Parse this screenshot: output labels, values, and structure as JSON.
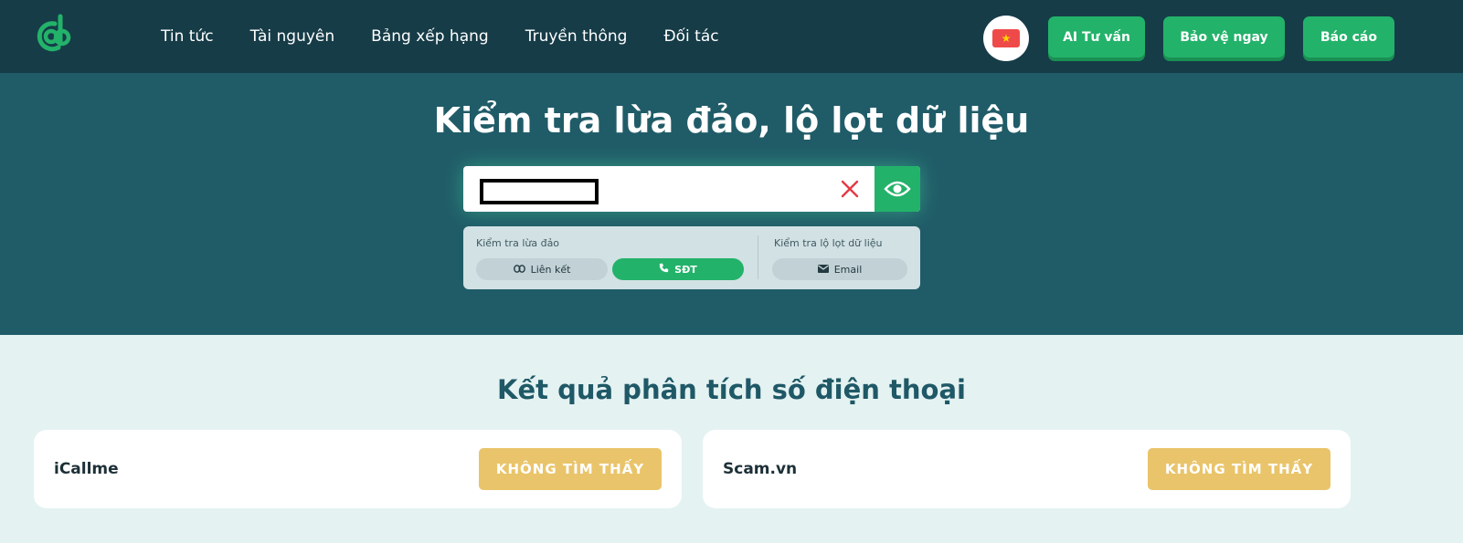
{
  "header": {
    "nav": [
      "Tin tức",
      "Tài nguyên",
      "Bảng xếp hạng",
      "Truyền thông",
      "Đối tác"
    ],
    "buttons": {
      "ai": "AI Tư vấn",
      "protect": "Bảo vệ ngay",
      "report": "Báo cáo"
    },
    "language_flag_icon": "vietnam-flag-icon"
  },
  "hero": {
    "title": "Kiểm tra lừa đảo, lộ lọt dữ liệu",
    "search": {
      "value": "",
      "placeholder": ""
    },
    "panel": {
      "scam_label": "Kiểm tra lừa đảo",
      "leak_label": "Kiểm tra lộ lọt dữ liệu",
      "options": {
        "link": "Liên kết",
        "phone": "SĐT",
        "email": "Email"
      },
      "selected": "phone"
    }
  },
  "results": {
    "title": "Kết quả phân tích số điện thoại",
    "items": [
      {
        "name": "iCallme",
        "status": "KHÔNG TÌM THẤY"
      },
      {
        "name": "Scam.vn",
        "status": "KHÔNG TÌM THẤY"
      }
    ]
  },
  "colors": {
    "header_bg": "#163c48",
    "hero_bg": "#205c68",
    "accent_green": "#23b26a",
    "page_bg": "#e4f2f2",
    "badge_yellow": "#e9c46a",
    "title_teal": "#1f5866"
  }
}
